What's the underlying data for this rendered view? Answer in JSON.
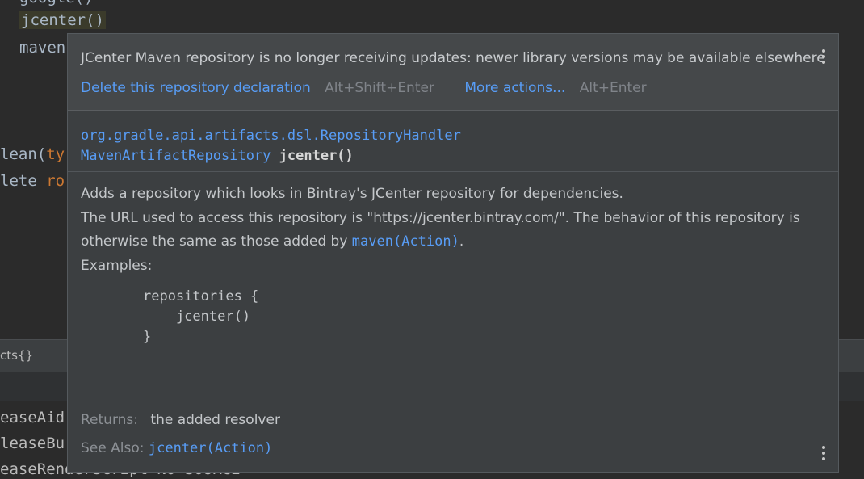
{
  "editor": {
    "lines": [
      {
        "text": "google()"
      },
      {
        "text": "jcenter()"
      },
      {
        "text": "maven"
      },
      {
        "text": "lean(",
        "suffix": "ty"
      },
      {
        "text": "lete ",
        "suffix": "ro"
      }
    ],
    "tab_label": "cts{}",
    "console_lines": [
      "easeAid",
      "leaseBu",
      "easeRenderScript NO-SOURCE"
    ]
  },
  "popup": {
    "warning": "JCenter Maven repository is no longer receiving updates: newer library versions may be available elsewhere",
    "actions": {
      "delete_label": "Delete this repository declaration",
      "delete_keys": "Alt+Shift+Enter",
      "more_label": "More actions...",
      "more_keys": "Alt+Enter"
    },
    "signature": {
      "class_name": "org.gradle.api.artifacts.dsl.RepositoryHandler",
      "return_type": "MavenArtifactRepository",
      "method": "jcenter()"
    },
    "description": {
      "line1": "Adds a repository which looks in Bintray's JCenter repository for dependencies.",
      "line2a": "The URL used to access this repository is \"https://jcenter.bintray.com/\". The behavior of this repository is otherwise the same as those added by ",
      "line2_link": "maven(Action)",
      "line2b": "."
    },
    "examples_label": "Examples:",
    "code": [
      "repositories {",
      "    jcenter()",
      "}"
    ],
    "returns_label": "Returns:",
    "returns_value": "the added resolver",
    "see_also_label": "See Also:",
    "see_also_link": "jcenter(Action)"
  },
  "colors": {
    "link": "#589df6",
    "popup_bg": "#3c3f41",
    "warning_bg": "#45484a"
  }
}
